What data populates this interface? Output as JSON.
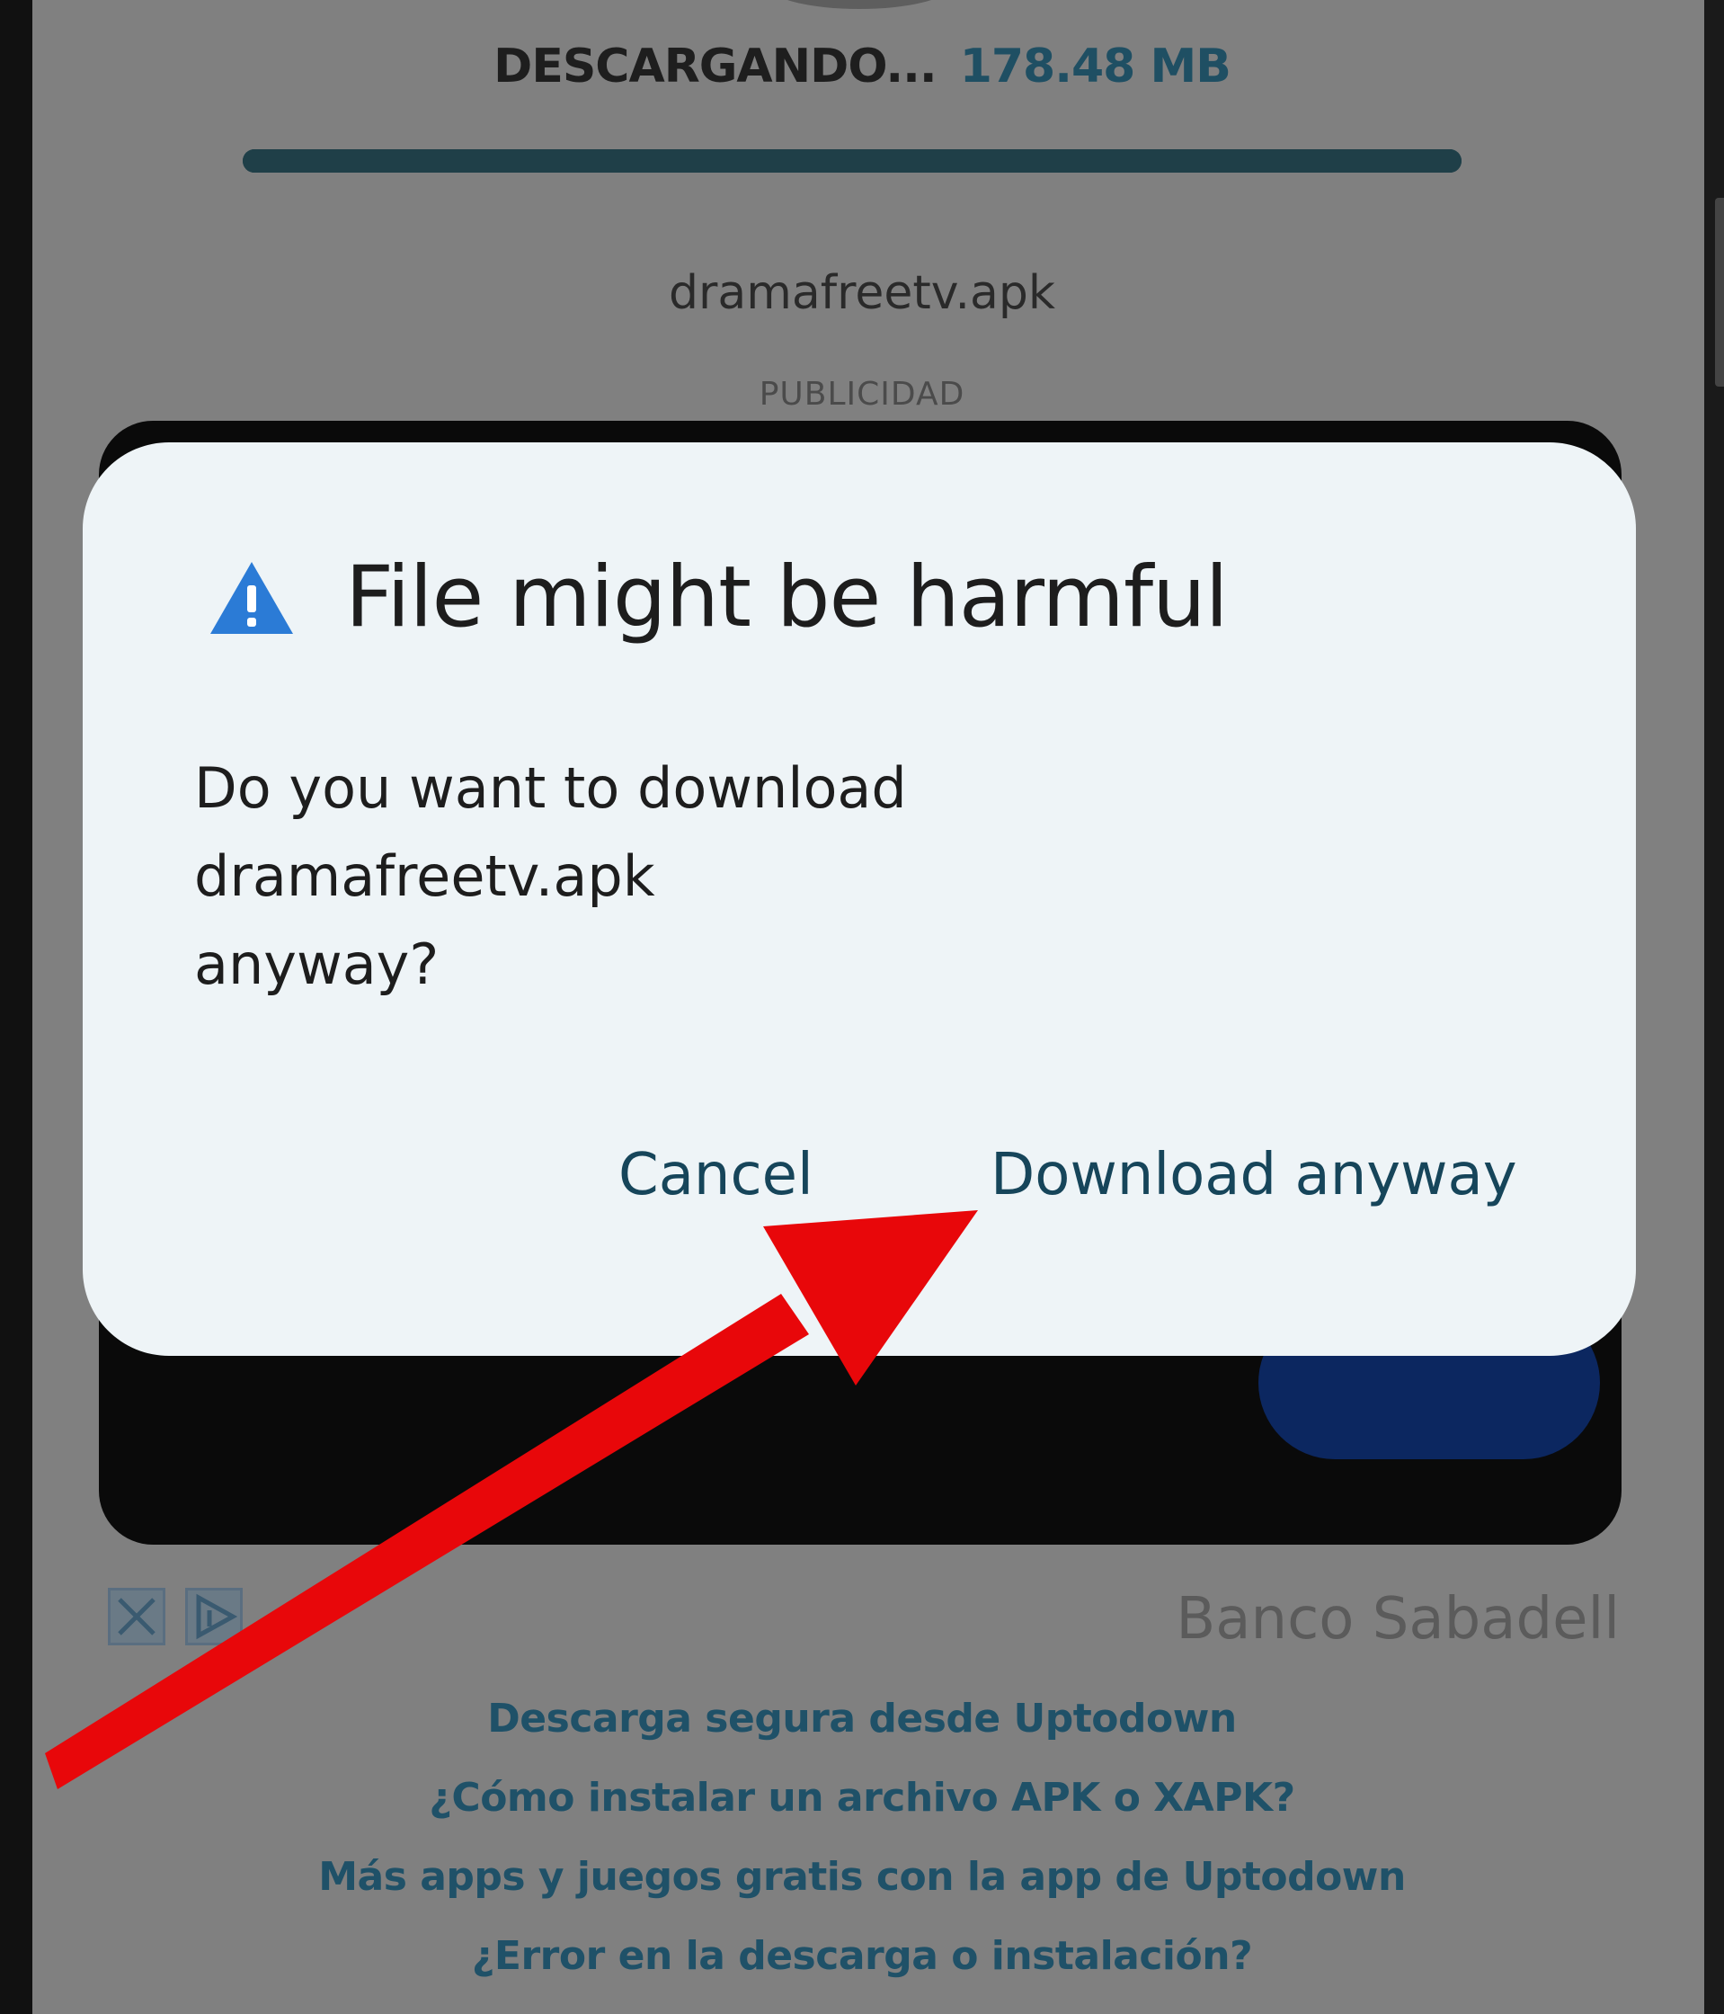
{
  "download": {
    "status_label": "DESCARGANDO...",
    "size": "178.48 MB",
    "progress": 1.0,
    "file_name": "dramafreetv.apk",
    "ad_label": "PUBLICIDAD"
  },
  "ad": {
    "brand": "Banco Sabadell",
    "close_icon": "close-icon",
    "info_icon": "adchoices-icon"
  },
  "dialog": {
    "title": "File might be harmful",
    "icon": "warning-icon",
    "body_lines": [
      "Do you want to download",
      "dramafreetv.apk",
      "anyway?"
    ],
    "cancel_label": "Cancel",
    "confirm_label": "Download anyway"
  },
  "help_links": [
    "Descarga segura desde Uptodown",
    "¿Cómo instalar un archivo APK o XAPK?",
    "Más apps y juegos gratis con la app de Uptodown",
    "¿Error en la descarga o instalación?"
  ],
  "colors": {
    "dialog_bg": "#eef4f7",
    "accent_text": "#16455a",
    "warning_blue": "#2b7bd6",
    "arrow_red": "#e8070a",
    "scrim": "#808080"
  }
}
